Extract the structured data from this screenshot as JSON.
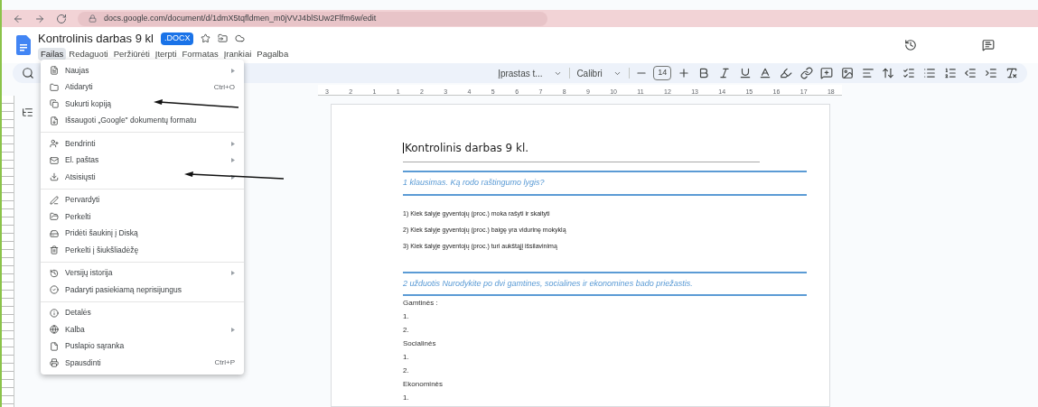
{
  "browser": {
    "url": "docs.google.com/document/d/1dmX5tqfldmen_m0jVVJ4blSUw2Flfm6w/edit"
  },
  "document_header": {
    "title": "Kontrolinis darbas 9 kl",
    "badge": ".DOCX"
  },
  "menubar": [
    {
      "label": "Failas",
      "selected": true
    },
    {
      "label": "Redaguoti",
      "selected": false
    },
    {
      "label": "Peržiūrėti",
      "selected": false
    },
    {
      "label": "Įterpti",
      "selected": false
    },
    {
      "label": "Formatas",
      "selected": false
    },
    {
      "label": "Įrankiai",
      "selected": false
    },
    {
      "label": "Pagalba",
      "selected": false
    }
  ],
  "toolbar": {
    "style": "Įprastas t...",
    "font": "Calibri",
    "font_size": "14"
  },
  "ruler": [
    "3",
    "2",
    "1",
    "1",
    "2",
    "3",
    "4",
    "5",
    "6",
    "7",
    "8",
    "9",
    "10",
    "11",
    "12",
    "13",
    "14",
    "15",
    "16",
    "17",
    "18"
  ],
  "file_menu": [
    [
      {
        "kind": "new",
        "label": "Naujas",
        "submenu": true
      },
      {
        "kind": "folder",
        "label": "Atidaryti",
        "shortcut": "Ctrl+O",
        "submenu": false
      },
      {
        "kind": "copy",
        "label": "Sukurti kopiją",
        "submenu": false
      },
      {
        "kind": "save",
        "label": "Išsaugoti „Google\" dokumentų formatu",
        "submenu": false
      }
    ],
    [
      {
        "kind": "share",
        "label": "Bendrinti",
        "submenu": true
      },
      {
        "kind": "mail",
        "label": "El. paštas",
        "submenu": true
      },
      {
        "kind": "download",
        "label": "Atsisiųsti",
        "submenu": true
      }
    ],
    [
      {
        "kind": "rename",
        "label": "Pervardyti",
        "submenu": false
      },
      {
        "kind": "move",
        "label": "Perkelti",
        "submenu": false
      },
      {
        "kind": "drive",
        "label": "Pridėti šaukinį į Diską",
        "submenu": false
      },
      {
        "kind": "trash",
        "label": "Perkelti į šiukšliadėžę",
        "submenu": false
      }
    ],
    [
      {
        "kind": "history",
        "label": "Versijų istorija",
        "submenu": true
      },
      {
        "kind": "offline",
        "label": "Padaryti pasiekiamą neprisijungus",
        "submenu": false
      }
    ],
    [
      {
        "kind": "info",
        "label": "Detalės",
        "submenu": false
      },
      {
        "kind": "language",
        "label": "Kalba",
        "submenu": true
      },
      {
        "kind": "page",
        "label": "Puslapio sąranka",
        "submenu": false
      },
      {
        "kind": "print",
        "label": "Spausdinti",
        "shortcut": "Ctrl+P",
        "submenu": false
      }
    ]
  ],
  "page": {
    "title": "Kontrolinis darbas 9 kl.",
    "blocks": [
      {
        "kind": "heading",
        "text": "1 klausimas. Ką rodo raštingumo lygis?"
      },
      {
        "kind": "item",
        "text": "1) Kiek šalyje gyventojų  (proc.) moka rašyti ir skaityti"
      },
      {
        "kind": "item",
        "text": "2) Kiek šalyje gyventojų (proc.) baigę yra vidurinę mokyklą"
      },
      {
        "kind": "item",
        "text": "3) Kiek šalyje gyventojų (proc.)  turi aukštąjį išsilavinimą"
      },
      {
        "kind": "heading",
        "text": "2 užduotis  Nurodykite po dvi gamtines, socialines ir ekonomines bado priežastis."
      },
      {
        "kind": "small",
        "text": "Gamtinės :"
      },
      {
        "kind": "small",
        "text": "1."
      },
      {
        "kind": "small",
        "text": "2."
      },
      {
        "kind": "small",
        "text": "Socialinės"
      },
      {
        "kind": "small",
        "text": "1."
      },
      {
        "kind": "small",
        "text": "2."
      },
      {
        "kind": "small",
        "text": "Ekonominės"
      },
      {
        "kind": "small",
        "text": "1."
      }
    ]
  }
}
